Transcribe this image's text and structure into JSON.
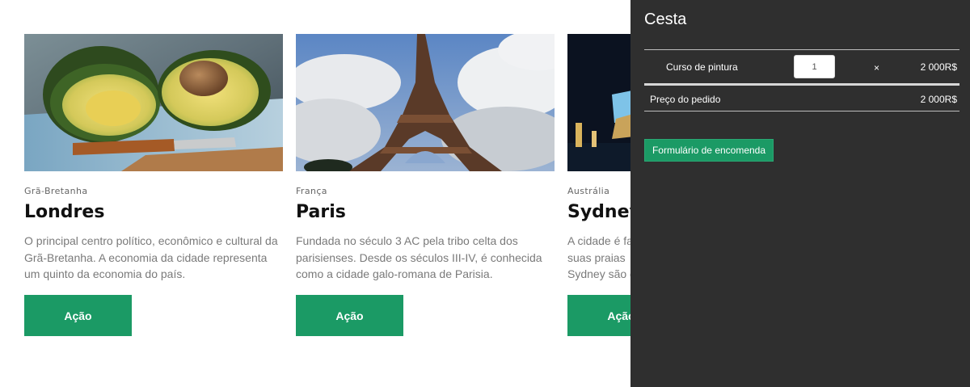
{
  "cards": [
    {
      "country": "Grã-Bretanha",
      "title": "Londres",
      "description": "O principal centro político, econômico e cultural da Grã-Bretanha. A economia da cidade representa um quinto da economia do país.",
      "button": "Ação"
    },
    {
      "country": "França",
      "title": "Paris",
      "description": "Fundada no século 3 AC pela tribo celta dos parisienses. Desde os séculos III-IV, é conhecida como a cidade galo-romana de Parisia.",
      "button": "Ação"
    },
    {
      "country": "Austrália",
      "title": "Sydney",
      "description": "A cidade é fa e suas praias Sydney são c",
      "button": "Ação"
    }
  ],
  "cart": {
    "title": "Cesta",
    "items": [
      {
        "name": "Curso de pintura",
        "quantity": "1",
        "times": "×",
        "price": "2 000R$"
      }
    ],
    "total_label": "Preço do pedido",
    "total_value": "2 000R$",
    "order_button": "Formulário de encomenda"
  },
  "colors": {
    "accent": "#1b9a65",
    "cart_background": "#2f2f2f"
  }
}
